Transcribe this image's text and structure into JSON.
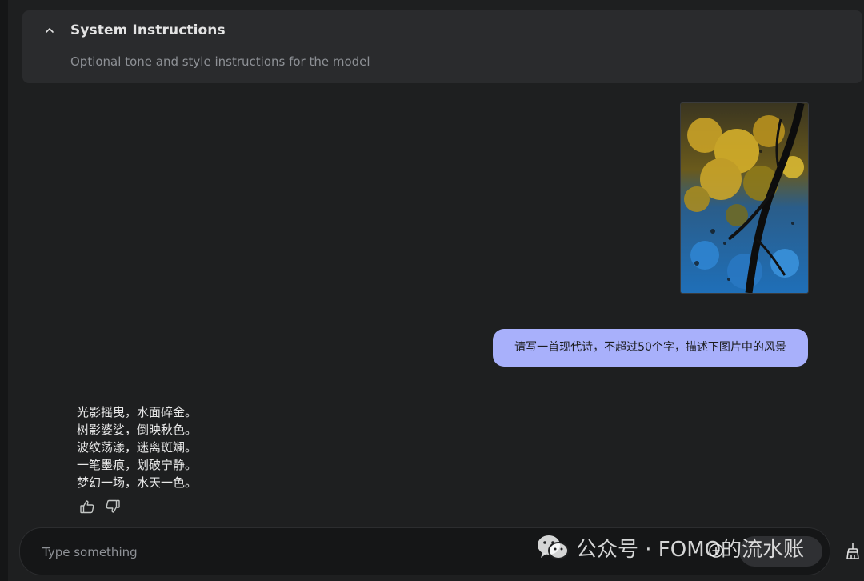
{
  "system_instructions": {
    "title": "System Instructions",
    "placeholder": "Optional tone and style instructions for the model"
  },
  "chat": {
    "user_prompt": "请写一首现代诗，不超过50个字，描述下图片中的风景",
    "model_reply_lines": [
      "光影摇曳，水面碎金。",
      "树影婆娑，倒映秋色。",
      "波纹荡漾，迷离斑斓。",
      "一笔墨痕，划破宁静。",
      "梦幻一场，水天一色。"
    ]
  },
  "composer": {
    "placeholder": "Type something"
  },
  "watermark": {
    "text": "公众号 · FOMO的流水账"
  },
  "icons": {
    "collapse": "chevron-up-icon",
    "thumbs_up": "thumbs-up-icon",
    "thumbs_down": "thumbs-down-icon",
    "add": "add-circle-icon",
    "clear": "broom-icon"
  },
  "colors": {
    "background": "#1e1f20",
    "panel": "#2a2b2d",
    "user_bubble": "#a8b0fb",
    "input_bar": "#151617"
  }
}
